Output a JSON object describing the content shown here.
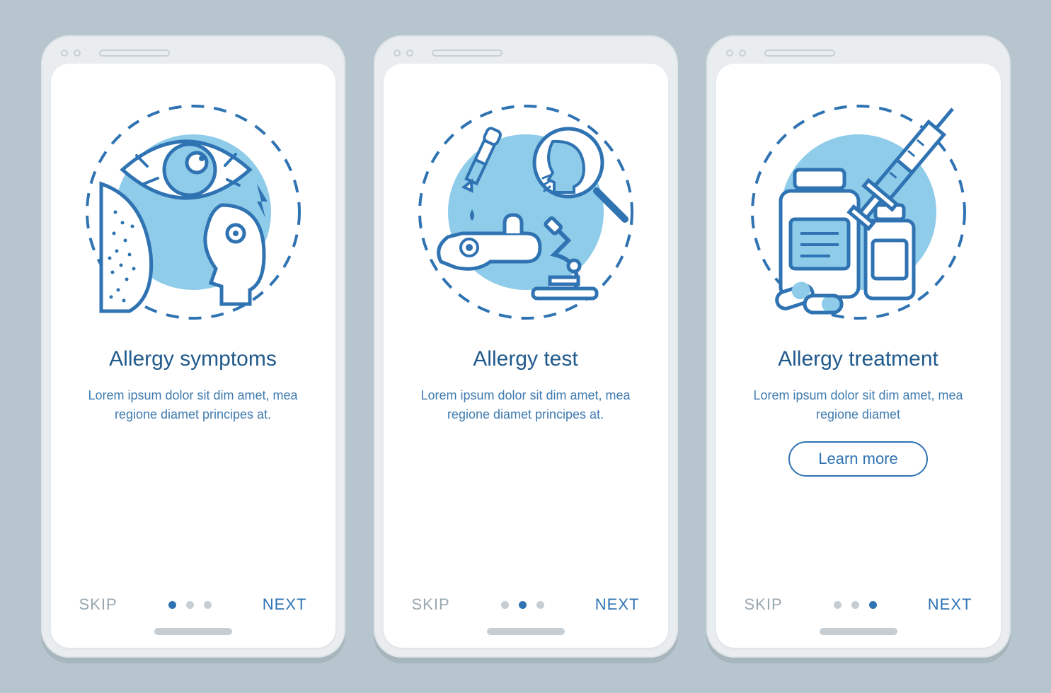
{
  "colors": {
    "primary": "#2f73b3",
    "accent_fill": "#8fcce9",
    "text_dark": "#215a8c",
    "text_light": "#3f7bb0",
    "muted": "#9aa7b0",
    "bg": "#b6c5ce"
  },
  "screens": [
    {
      "title": "Allergy symptoms",
      "body": "Lorem ipsum dolor sit dim amet, mea regione diamet principes at.",
      "skip_label": "SKIP",
      "next_label": "NEXT",
      "active_dot": 0,
      "total_dots": 3,
      "has_cta": false,
      "illustration": "symptoms"
    },
    {
      "title": "Allergy test",
      "body": "Lorem ipsum dolor sit dim amet, mea regione diamet principes at.",
      "skip_label": "SKIP",
      "next_label": "NEXT",
      "active_dot": 1,
      "total_dots": 3,
      "has_cta": false,
      "illustration": "test"
    },
    {
      "title": "Allergy treatment",
      "body": "Lorem ipsum dolor sit dim amet, mea regione diamet",
      "skip_label": "SKIP",
      "next_label": "NEXT",
      "active_dot": 2,
      "total_dots": 3,
      "has_cta": true,
      "cta_label": "Learn more",
      "illustration": "treatment"
    }
  ]
}
